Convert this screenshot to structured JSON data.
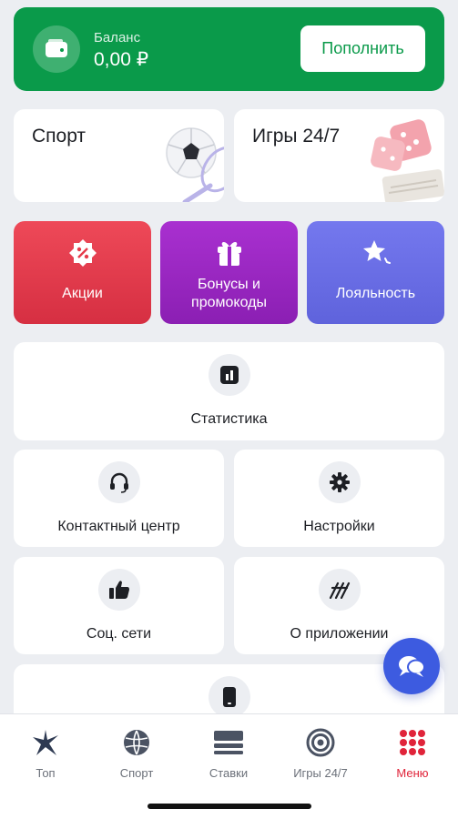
{
  "balance": {
    "label": "Баланс",
    "value": "0,00 ₽",
    "topup_label": "Пополнить",
    "icon": "wallet-icon"
  },
  "categories": [
    {
      "label": "Спорт",
      "icon": "soccer-tennis-image"
    },
    {
      "label": "Игры 24/7",
      "icon": "dice-image"
    }
  ],
  "promos": [
    {
      "label": "Акции",
      "icon": "discount-badge-icon",
      "color": "#e53a4a"
    },
    {
      "label": "Бонусы и промокоды",
      "icon": "gift-box-icon",
      "color": "#9c27c6"
    },
    {
      "label": "Лояльность",
      "icon": "star-sparkle-icon",
      "color": "#6b6ee8"
    }
  ],
  "menu": {
    "statistics": "Статистика",
    "contact_center": "Контактный центр",
    "settings": "Настройки",
    "social": "Соц. сети",
    "about": "О приложении"
  },
  "tabs": [
    {
      "label": "Топ",
      "icon": "star-burst-icon"
    },
    {
      "label": "Спорт",
      "icon": "ball-icon"
    },
    {
      "label": "Ставки",
      "icon": "coupon-stack-icon"
    },
    {
      "label": "Игры 24/7",
      "icon": "target-icon"
    },
    {
      "label": "Меню",
      "icon": "grid-dots-icon",
      "active": true
    }
  ],
  "colors": {
    "brand_green": "#0a9a4a",
    "accent_red": "#e0243a",
    "fab_blue": "#3d5be0"
  }
}
